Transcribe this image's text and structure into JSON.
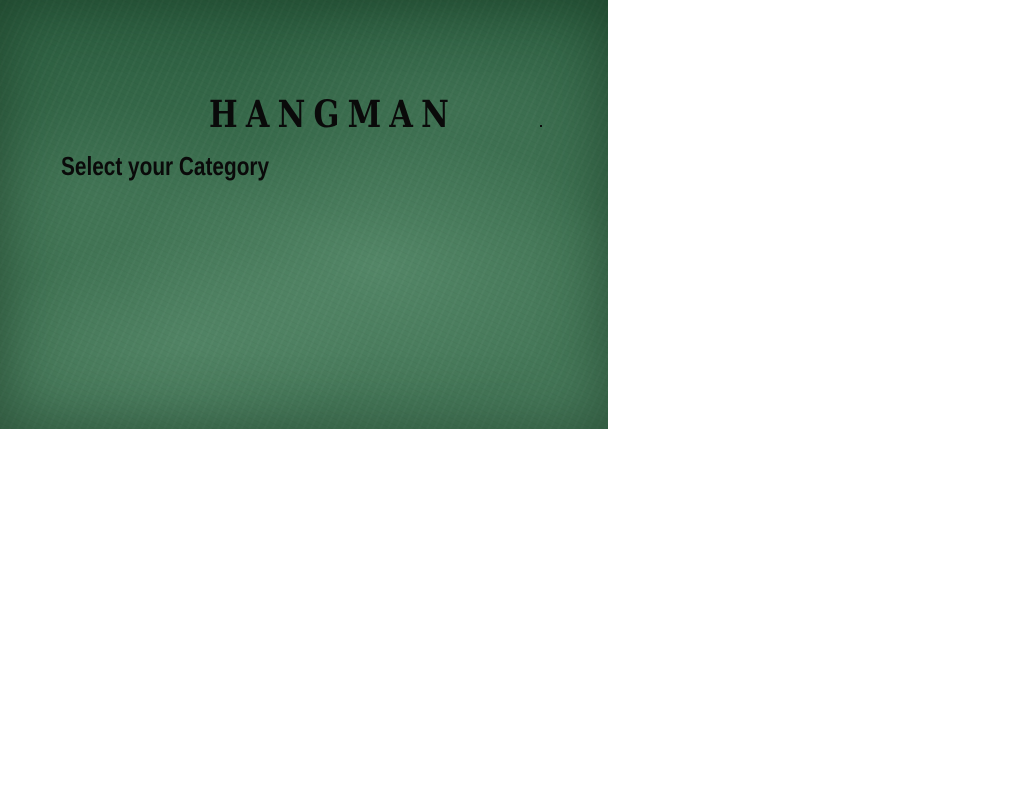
{
  "game": {
    "title": "HANGMAN",
    "prompt": "Select your Category"
  },
  "colors": {
    "board": "#3a6b4c",
    "text": "#0a0a0a",
    "page_background": "#ffffff"
  }
}
